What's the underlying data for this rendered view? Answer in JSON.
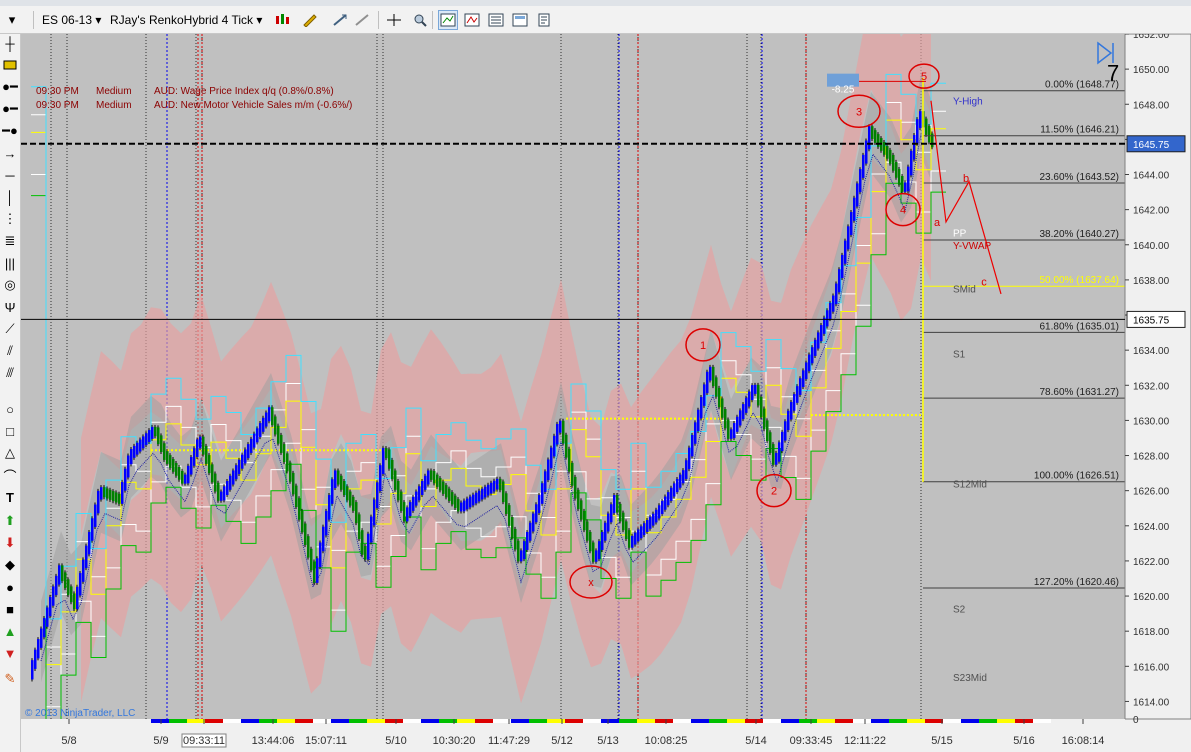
{
  "toolbar": {
    "instrument": "ES 06-13",
    "chart_style": "RJay's RenkoHybrid  4 Tick"
  },
  "icons": {
    "left_tools": [
      "crosshair-icon",
      "highlight-icon",
      "line-icon",
      "ray-icon",
      "extended-line-icon",
      "arrow-line-icon",
      "horizontal-line-icon",
      "vertical-line-icon",
      "fib-extension-icon",
      "fib-retracement-icon",
      "fib-timezone-icon",
      "fib-circle-icon",
      "andrews-pitchfork-icon",
      "gann-fan-icon",
      "regression-channel-icon",
      "trend-channel-icon",
      "ellipse-icon",
      "rectangle-icon",
      "triangle-icon",
      "arc-icon",
      "text-icon",
      "arrow-up-icon",
      "arrow-down-icon",
      "diamond-icon",
      "dot-icon",
      "square-icon",
      "triangle-up-icon",
      "triangle-down-icon",
      "pin-icon"
    ]
  },
  "news": [
    {
      "time": "09:30 PM",
      "impact": "Medium",
      "text": "AUD: Wage Price Index q/q (0.8%/0.8%)"
    },
    {
      "time": "09:30 PM",
      "impact": "Medium",
      "text": "AUD: New Motor Vehicle Sales m/m (-0.6%/)"
    }
  ],
  "colors": {
    "chart_bg": "#c0c0c0",
    "up_bar": "#0000ff",
    "down_bar": "#008000",
    "cloud": "#e8a0a0",
    "fib_line": "#404040",
    "current_price_line": "#000000",
    "label_red": "#cc0000",
    "label_blue": "#3333cc"
  },
  "chart_data": {
    "type": "candlestick-renko",
    "ylim": [
      1613,
      1652
    ],
    "y_ticks": [
      1614,
      1616,
      1618,
      1620,
      1622,
      1624,
      1626,
      1628,
      1630,
      1632,
      1634,
      1636,
      1638,
      1640,
      1642,
      1644,
      1646,
      1648,
      1650,
      1652
    ],
    "x_ticks": [
      "5/8",
      "5/9",
      "09:33:11",
      "13:44:06",
      "15:07:11",
      "5/10",
      "10:30:20",
      "11:47:29",
      "5/12",
      "5/13",
      "10:08:25",
      "5/14",
      "09:33:45",
      "12:11:22",
      "5/15",
      "5/16",
      "16:08:14"
    ],
    "price_flags": [
      {
        "label": "1645.75",
        "value": 1645.75,
        "style": "blue"
      },
      {
        "label": "1635.75",
        "value": 1635.75,
        "style": "white"
      }
    ],
    "fib_levels": [
      {
        "label": "0.00% (1648.77)",
        "value": 1648.77
      },
      {
        "label": "11.50% (1646.21)",
        "value": 1646.21
      },
      {
        "label": "23.60% (1643.52)",
        "value": 1643.52
      },
      {
        "label": "38.20% (1640.27)",
        "value": 1640.27
      },
      {
        "label": "50.00% (1637.64)",
        "value": 1637.64,
        "highlight": true
      },
      {
        "label": "61.80% (1635.01)",
        "value": 1635.01
      },
      {
        "label": "78.60% (1631.27)",
        "value": 1631.27
      },
      {
        "label": "100.00% (1626.51)",
        "value": 1626.51
      },
      {
        "label": "127.20% (1620.46)",
        "value": 1620.46
      }
    ],
    "pivot_labels": [
      {
        "label": "Y-High",
        "value": 1648.2
      },
      {
        "label": "PP",
        "value": 1640.7
      },
      {
        "label": "Y-VWAP",
        "value": 1640.0
      },
      {
        "label": "SMid",
        "value": 1637.5
      },
      {
        "label": "S1",
        "value": 1633.8
      },
      {
        "label": "S12Mid",
        "value": 1626.4
      },
      {
        "label": "S2",
        "value": 1619.3
      },
      {
        "label": "S23Mid",
        "value": 1615.4
      }
    ],
    "wave_labels": [
      {
        "label": "1",
        "value": 1634.3,
        "style": "circle"
      },
      {
        "label": "2",
        "value": 1626.0,
        "style": "circle"
      },
      {
        "label": "3",
        "value": 1647.6,
        "style": "circle"
      },
      {
        "label": "4",
        "value": 1642.0,
        "style": "circle"
      },
      {
        "label": "5",
        "value": 1649.6,
        "style": "circle"
      },
      {
        "label": "x",
        "value": 1620.8,
        "style": "circle"
      },
      {
        "label": "a",
        "value": 1641.3,
        "style": "letter"
      },
      {
        "label": "b",
        "value": 1643.8,
        "style": "letter"
      },
      {
        "label": "c",
        "value": 1637.9,
        "style": "letter"
      }
    ],
    "annotations": [
      {
        "label": "-8.25",
        "value": 1648.9
      },
      {
        "label": "7",
        "value": 1649.8
      },
      {
        "label": "© 2013 NinjaTrader, LLC",
        "value": null
      },
      {
        "label": "0",
        "value": null
      }
    ]
  }
}
